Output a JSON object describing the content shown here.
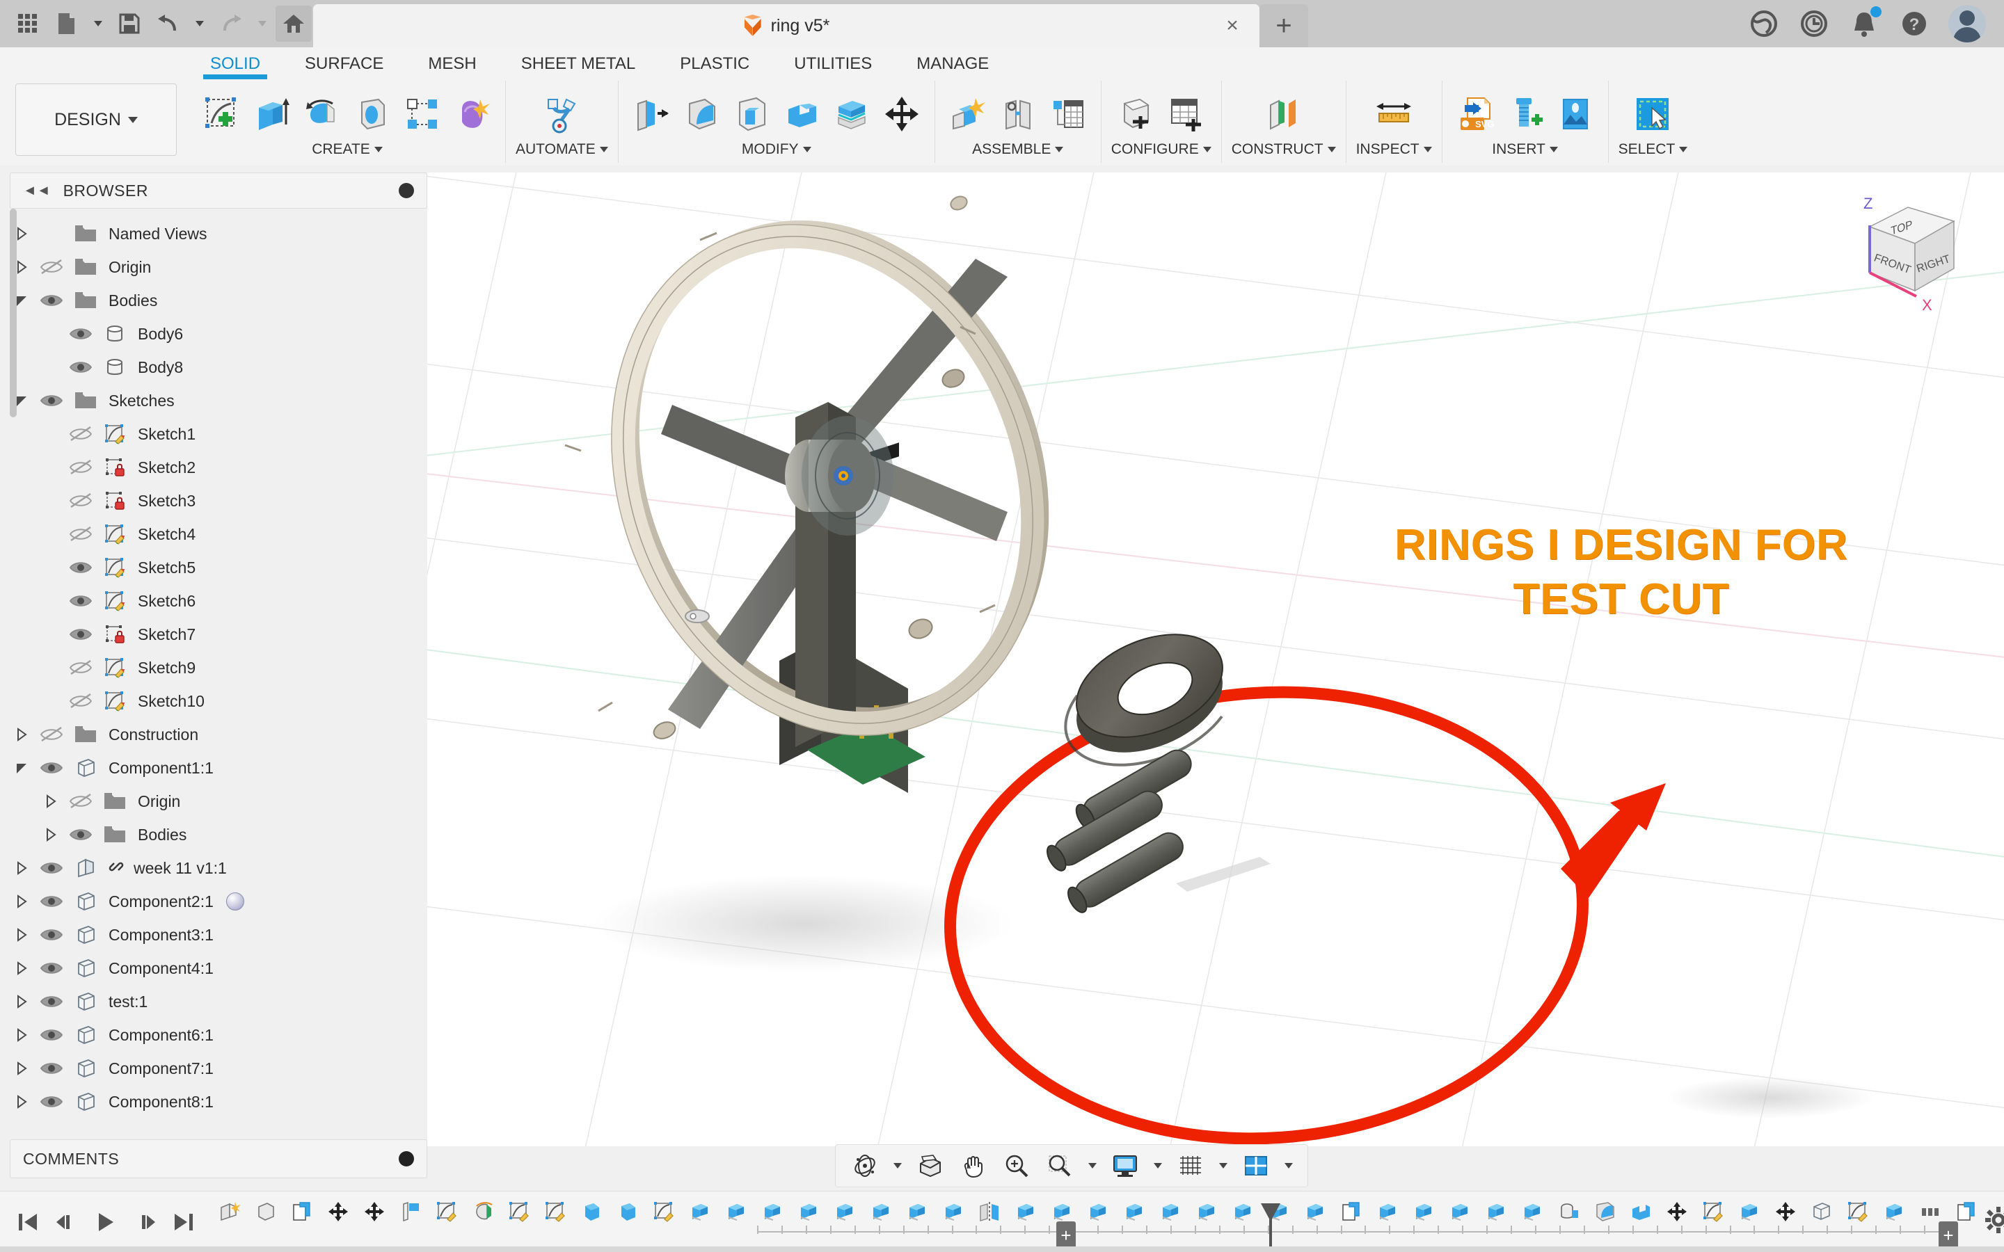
{
  "app": {
    "name": "Autodesk Fusion"
  },
  "titlebar": {
    "quick_access": [
      {
        "name": "app-grid-icon",
        "label": "App Grid"
      },
      {
        "name": "new-file-icon",
        "label": "New"
      },
      {
        "name": "save-icon",
        "label": "Save"
      },
      {
        "name": "undo-icon",
        "label": "Undo"
      },
      {
        "name": "redo-icon",
        "label": "Redo"
      },
      {
        "name": "home-icon",
        "label": "Home"
      }
    ],
    "tab": {
      "title": "ring v5*",
      "close_label": "×",
      "icon": "fusion-cube-icon"
    },
    "new_tab_label": "+",
    "right_icons": [
      {
        "name": "share-globe-icon",
        "label": "Share"
      },
      {
        "name": "job-status-clock-icon",
        "label": "Job Status"
      },
      {
        "name": "notifications-bell-icon",
        "label": "Notifications",
        "badge": true
      },
      {
        "name": "help-icon",
        "label": "Help"
      },
      {
        "name": "user-avatar",
        "label": "Account"
      }
    ]
  },
  "ribbon": {
    "tabs": [
      {
        "label": "SOLID",
        "active": true
      },
      {
        "label": "SURFACE",
        "active": false
      },
      {
        "label": "MESH",
        "active": false
      },
      {
        "label": "SHEET METAL",
        "active": false
      },
      {
        "label": "PLASTIC",
        "active": false
      },
      {
        "label": "UTILITIES",
        "active": false
      },
      {
        "label": "MANAGE",
        "active": false
      }
    ],
    "workspace_label": "DESIGN",
    "panels": [
      {
        "label": "CREATE",
        "tools": [
          "create-sketch-icon",
          "extrude-icon",
          "revolve-icon",
          "sweep-icon",
          "pattern-icon",
          "form-icon"
        ]
      },
      {
        "label": "AUTOMATE",
        "tools": [
          "automate-icon"
        ]
      },
      {
        "label": "MODIFY",
        "tools": [
          "press-pull-icon",
          "fillet-icon",
          "shell-icon",
          "combine-icon",
          "split-face-icon",
          "move-copy-icon"
        ]
      },
      {
        "label": "ASSEMBLE",
        "tools": [
          "new-component-icon",
          "joint-icon",
          "bom-icon"
        ]
      },
      {
        "label": "CONFIGURE",
        "tools": [
          "configure-design-icon",
          "configuration-table-icon"
        ]
      },
      {
        "label": "CONSTRUCT",
        "tools": [
          "offset-plane-icon"
        ]
      },
      {
        "label": "INSPECT",
        "tools": [
          "measure-icon"
        ]
      },
      {
        "label": "INSERT",
        "tools": [
          "insert-svg-icon",
          "insert-mcmaster-icon",
          "insert-image-icon"
        ]
      },
      {
        "label": "SELECT",
        "tools": [
          "select-window-icon"
        ]
      }
    ]
  },
  "browser": {
    "title": "BROWSER",
    "collapse_icon": "collapse-left-icon",
    "options_icon": "browser-options-icon",
    "items": [
      {
        "label": "Named Views",
        "indent": 0,
        "expander": "closed",
        "eye": "none",
        "icon": "folder-icon"
      },
      {
        "label": "Origin",
        "indent": 0,
        "expander": "closed",
        "eye": "hidden",
        "icon": "folder-icon"
      },
      {
        "label": "Bodies",
        "indent": 0,
        "expander": "open",
        "eye": "visible",
        "icon": "folder-icon"
      },
      {
        "label": "Body6",
        "indent": 1,
        "expander": "none",
        "eye": "visible",
        "icon": "body-icon"
      },
      {
        "label": "Body8",
        "indent": 1,
        "expander": "none",
        "eye": "visible",
        "icon": "body-icon"
      },
      {
        "label": "Sketches",
        "indent": 0,
        "expander": "open",
        "eye": "visible",
        "icon": "folder-icon"
      },
      {
        "label": "Sketch1",
        "indent": 1,
        "expander": "none",
        "eye": "hidden",
        "icon": "sketch-icon"
      },
      {
        "label": "Sketch2",
        "indent": 1,
        "expander": "none",
        "eye": "hidden",
        "icon": "sketch-locked-icon"
      },
      {
        "label": "Sketch3",
        "indent": 1,
        "expander": "none",
        "eye": "hidden",
        "icon": "sketch-locked-icon"
      },
      {
        "label": "Sketch4",
        "indent": 1,
        "expander": "none",
        "eye": "hidden",
        "icon": "sketch-icon"
      },
      {
        "label": "Sketch5",
        "indent": 1,
        "expander": "none",
        "eye": "visible",
        "icon": "sketch-icon"
      },
      {
        "label": "Sketch6",
        "indent": 1,
        "expander": "none",
        "eye": "visible",
        "icon": "sketch-icon"
      },
      {
        "label": "Sketch7",
        "indent": 1,
        "expander": "none",
        "eye": "visible",
        "icon": "sketch-locked-icon"
      },
      {
        "label": "Sketch9",
        "indent": 1,
        "expander": "none",
        "eye": "hidden",
        "icon": "sketch-icon"
      },
      {
        "label": "Sketch10",
        "indent": 1,
        "expander": "none",
        "eye": "hidden",
        "icon": "sketch-icon"
      },
      {
        "label": "Construction",
        "indent": 0,
        "expander": "closed",
        "eye": "hidden",
        "icon": "folder-icon"
      },
      {
        "label": "Component1:1",
        "indent": 0,
        "expander": "open",
        "eye": "visible",
        "icon": "component-icon"
      },
      {
        "label": "Origin",
        "indent": 1,
        "expander": "closed",
        "eye": "hidden",
        "icon": "folder-icon"
      },
      {
        "label": "Bodies",
        "indent": 1,
        "expander": "closed",
        "eye": "visible",
        "icon": "folder-icon"
      },
      {
        "label": "week 11 v1:1",
        "indent": 0,
        "expander": "closed",
        "eye": "visible",
        "icon": "linked-component-icon",
        "link": true
      },
      {
        "label": "Component2:1",
        "indent": 0,
        "expander": "closed",
        "eye": "visible",
        "icon": "component-icon",
        "appearance": true
      },
      {
        "label": "Component3:1",
        "indent": 0,
        "expander": "closed",
        "eye": "visible",
        "icon": "component-icon"
      },
      {
        "label": "Component4:1",
        "indent": 0,
        "expander": "closed",
        "eye": "visible",
        "icon": "component-icon"
      },
      {
        "label": "test:1",
        "indent": 0,
        "expander": "closed",
        "eye": "visible",
        "icon": "component-icon"
      },
      {
        "label": "Component6:1",
        "indent": 0,
        "expander": "closed",
        "eye": "visible",
        "icon": "component-icon"
      },
      {
        "label": "Component7:1",
        "indent": 0,
        "expander": "closed",
        "eye": "visible",
        "icon": "component-icon"
      },
      {
        "label": "Component8:1",
        "indent": 0,
        "expander": "closed",
        "eye": "visible",
        "icon": "component-icon"
      }
    ]
  },
  "comments": {
    "title": "COMMENTS",
    "add_icon": "add-comment-icon"
  },
  "canvas": {
    "annotation": {
      "line1": "RINGS I DESIGN FOR",
      "line2": "TEST CUT",
      "color": "#F39200"
    },
    "arrow": {
      "color": "#EE2200"
    },
    "highlight_ellipse": {
      "color": "#EE2200"
    },
    "viewcube": {
      "top_label": "TOP",
      "front_label": "FRONT",
      "right_label": "RIGHT",
      "axis_z": "Z",
      "axis_x": "X",
      "z_color": "#6a5acd",
      "x_color": "#e8407a"
    }
  },
  "navbar": {
    "buttons": [
      {
        "name": "orbit-icon",
        "label": "Orbit",
        "caret": true
      },
      {
        "name": "look-at-icon",
        "label": "Look At",
        "caret": false
      },
      {
        "name": "pan-icon",
        "label": "Pan",
        "caret": false
      },
      {
        "name": "zoom-icon",
        "label": "Zoom",
        "caret": false
      },
      {
        "name": "fit-icon",
        "label": "Fit",
        "caret": true
      },
      {
        "name": "display-settings-icon",
        "label": "Display Settings",
        "caret": true
      },
      {
        "name": "grid-snaps-icon",
        "label": "Grid and Snaps",
        "caret": true
      },
      {
        "name": "viewport-layout-icon",
        "label": "Viewports",
        "caret": true
      }
    ]
  },
  "timeline": {
    "playback": [
      {
        "name": "timeline-go-to-beginning-icon",
        "label": "Go to Beginning"
      },
      {
        "name": "timeline-step-back-icon",
        "label": "Step Back"
      },
      {
        "name": "timeline-play-icon",
        "label": "Play"
      },
      {
        "name": "timeline-step-forward-icon",
        "label": "Step Forward"
      },
      {
        "name": "timeline-go-to-end-icon",
        "label": "Go to End"
      }
    ],
    "features": [
      "new-component-feature-icon",
      "body-feature-icon",
      "copy-paste-feature-icon",
      "move-feature-icon",
      "move-feature-icon",
      "plane-feature-icon",
      "sketch-feature-icon",
      "revolve-feature-icon",
      "sketch-feature-icon",
      "sketch-feature-icon",
      "sweep-feature-icon",
      "sweep-feature-icon",
      "sketch-feature-icon",
      "extrude-feature-icon",
      "extrude-feature-icon",
      "extrude-feature-icon",
      "extrude-feature-icon",
      "extrude-feature-icon",
      "extrude-feature-icon",
      "extrude-feature-icon",
      "extrude-feature-icon",
      "mirror-feature-icon",
      "extrude-feature-icon",
      "extrude-feature-icon",
      "extrude-feature-icon",
      "extrude-feature-icon",
      "extrude-feature-icon",
      "extrude-feature-icon",
      "extrude-feature-icon",
      "extrude-feature-icon",
      "extrude-feature-icon",
      "copy-paste-feature-icon",
      "extrude-feature-icon",
      "extrude-feature-icon",
      "extrude-feature-icon",
      "extrude-feature-icon",
      "extrude-feature-icon",
      "hole-feature-icon",
      "fillet-feature-icon",
      "combine-feature-icon",
      "move-feature-icon",
      "sketch-feature-icon",
      "extrude-feature-icon",
      "move-feature-icon",
      "component-feature-icon",
      "sketch-feature-icon",
      "extrude-feature-icon",
      "group-feature-icon",
      "copy-paste-feature-icon"
    ],
    "settings_icon": "timeline-settings-gear-icon",
    "expand_left_label": "+",
    "expand_right_label": "+"
  }
}
